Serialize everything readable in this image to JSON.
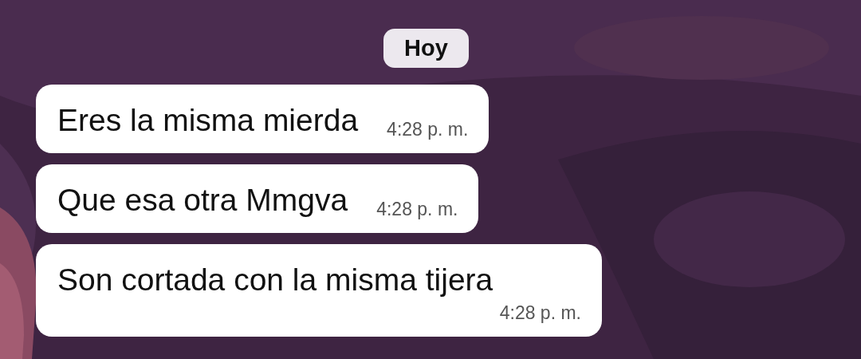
{
  "date_chip": "Hoy",
  "messages": [
    {
      "text": "Eres la misma mierda",
      "time": "4:28 p. m."
    },
    {
      "text": "Que esa otra Mmgva",
      "time": "4:28 p. m."
    },
    {
      "text": "Son cortada con la misma tijera",
      "time": "4:28 p. m."
    }
  ]
}
